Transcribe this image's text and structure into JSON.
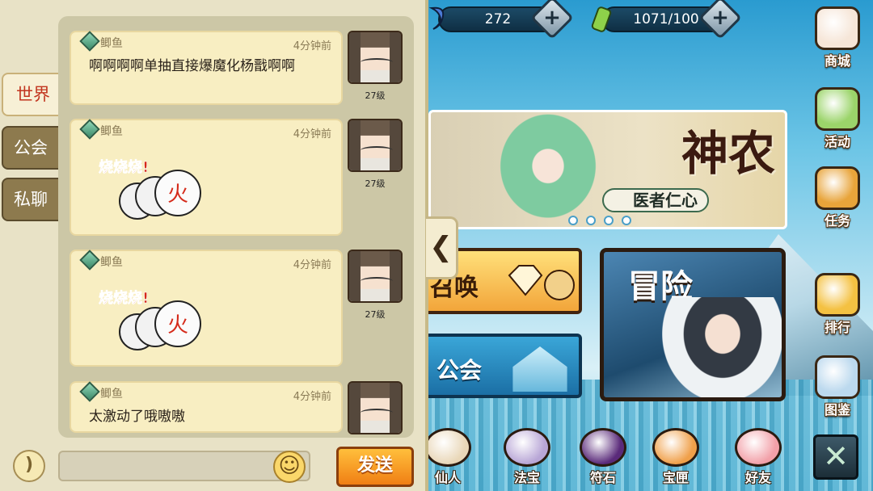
{
  "resources": {
    "gems": "272",
    "stamina": "1071/100"
  },
  "side_menu": [
    {
      "id": "shop",
      "label": "商城",
      "icon": "lucky-cat-icon",
      "color": "#f6e6d8"
    },
    {
      "id": "events",
      "label": "活动",
      "icon": "gift-box-icon",
      "color": "#9bd46a"
    },
    {
      "id": "quests",
      "label": "任务",
      "icon": "scroll-bag-icon",
      "color": "#e8a43a"
    },
    {
      "id": "rank",
      "label": "排行",
      "icon": "trophy-icon",
      "color": "#f4c142"
    },
    {
      "id": "codex",
      "label": "图鉴",
      "icon": "book-icon",
      "color": "#bcd9ee"
    }
  ],
  "banner": {
    "title": "神农",
    "subtitle": "医者仁心",
    "pages": 4
  },
  "main_buttons": {
    "summon": "召唤",
    "guild": "公会",
    "adventure": "冒险"
  },
  "bottom_menu": [
    {
      "id": "immortals",
      "label": "仙人",
      "icon": "immortal-icon",
      "color": "#e9d7b8"
    },
    {
      "id": "treasures",
      "label": "法宝",
      "icon": "treasure-icon",
      "color": "#b8a6d6"
    },
    {
      "id": "runes",
      "label": "符石",
      "icon": "rune-stone-icon",
      "color": "#5a2a7a"
    },
    {
      "id": "chests",
      "label": "宝匣",
      "icon": "treasure-bag-icon",
      "color": "#f0a04a"
    },
    {
      "id": "friends",
      "label": "好友",
      "icon": "octopus-icon",
      "color": "#f2a0a8"
    }
  ],
  "chat": {
    "tabs": [
      "世界",
      "公会",
      "私聊"
    ],
    "active_tab": "世界",
    "messages": [
      {
        "name": "鲫鱼",
        "time": "4分钟前",
        "text": "啊啊啊啊单抽直接爆魔化杨戬啊啊",
        "level": "27级"
      },
      {
        "name": "鲫鱼",
        "time": "4分钟前",
        "sticker": "烧烧烧!",
        "level": "27级"
      },
      {
        "name": "鲫鱼",
        "time": "4分钟前",
        "sticker": "烧烧烧!",
        "level": "27级"
      },
      {
        "name": "鲫鱼",
        "time": "4分钟前",
        "text": "太激动了哦嗷嗷",
        "level": ""
      }
    ],
    "input_value": "",
    "send_label": "发送",
    "collapse_glyph": "❮"
  }
}
